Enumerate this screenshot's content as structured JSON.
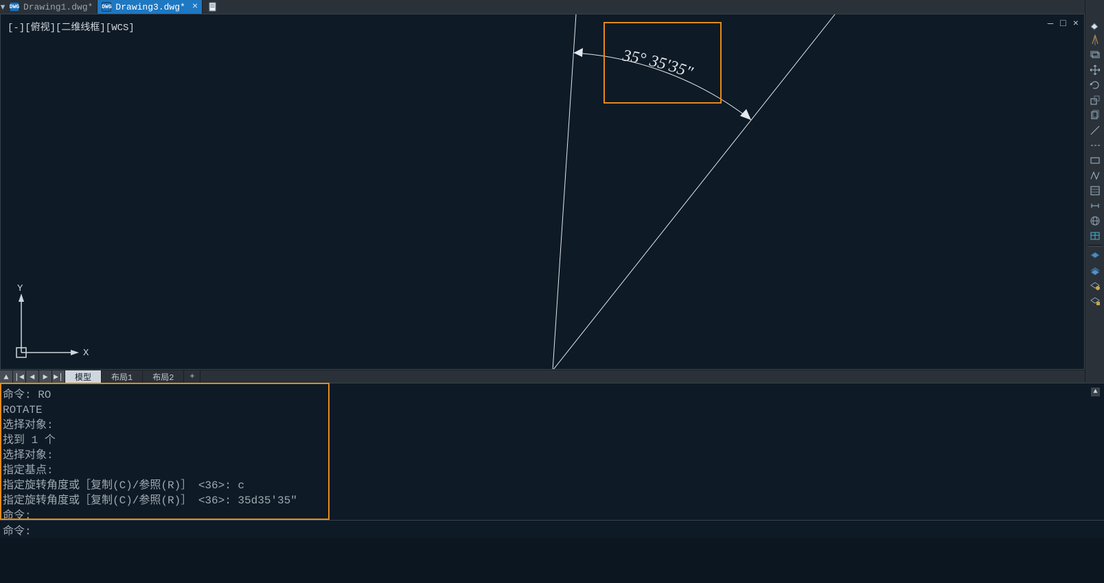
{
  "tabs": {
    "items": [
      {
        "label": "Drawing1.dwg*",
        "active": false,
        "closable": false
      },
      {
        "label": "Drawing3.dwg*",
        "active": true,
        "closable": true
      }
    ]
  },
  "viewport": {
    "label": "[-][俯视][二维线框][WCS]"
  },
  "ucs": {
    "x": "X",
    "y": "Y"
  },
  "drawing": {
    "angle_label": "35° 35'35\""
  },
  "layout_tabs": {
    "items": [
      "模型",
      "布局1",
      "布局2"
    ],
    "active_index": 0
  },
  "command_history": [
    "命令: RO",
    "ROTATE",
    "选择对象:",
    "找到 1 个",
    "选择对象:",
    "指定基点:",
    "指定旋转角度或［复制(C)/参照(R)］ <36>: c",
    "指定旋转角度或［复制(C)/参照(R)］ <36>: 35d35'35\"",
    "命令:"
  ],
  "command_input": {
    "prompt": "命令:",
    "value": ""
  },
  "sidebar": {
    "icons": [
      "eraser-icon",
      "mirror-icon",
      "layers-icon",
      "move-icon",
      "rotate-icon",
      "scale-icon",
      "copy-icon",
      "line-icon",
      "dash-icon",
      "rect-icon",
      "path-icon",
      "hatch-icon",
      "dim-icon",
      "globe-icon",
      "table-icon",
      "group1-divider",
      "layeriso-icon",
      "layerun-icon",
      "layerfrz-icon",
      "layerlk-icon"
    ]
  }
}
